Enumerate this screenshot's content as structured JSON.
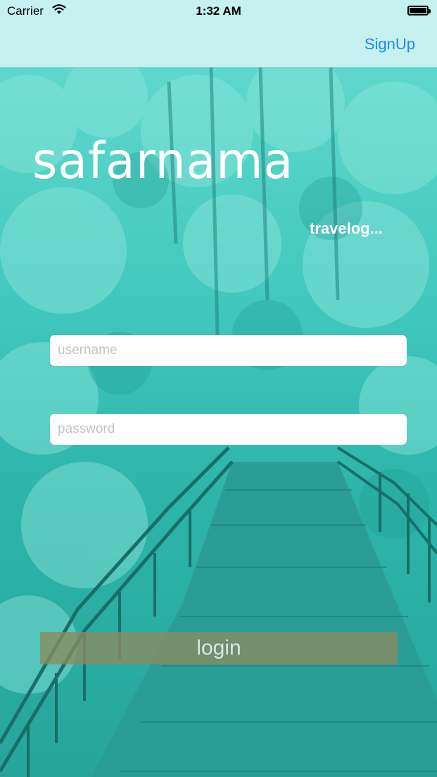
{
  "status_bar": {
    "carrier": "Carrier",
    "time": "1:32 AM"
  },
  "nav": {
    "signup_label": "SignUp"
  },
  "brand": {
    "title": "safarnama",
    "tagline": "travelog..."
  },
  "form": {
    "username_placeholder": "username",
    "username_value": "",
    "password_placeholder": "password",
    "password_value": "",
    "login_label": "login"
  },
  "colors": {
    "accent": "#1a8cf0",
    "background_tint": "#2bbcb2",
    "login_button": "#8a8a60"
  }
}
